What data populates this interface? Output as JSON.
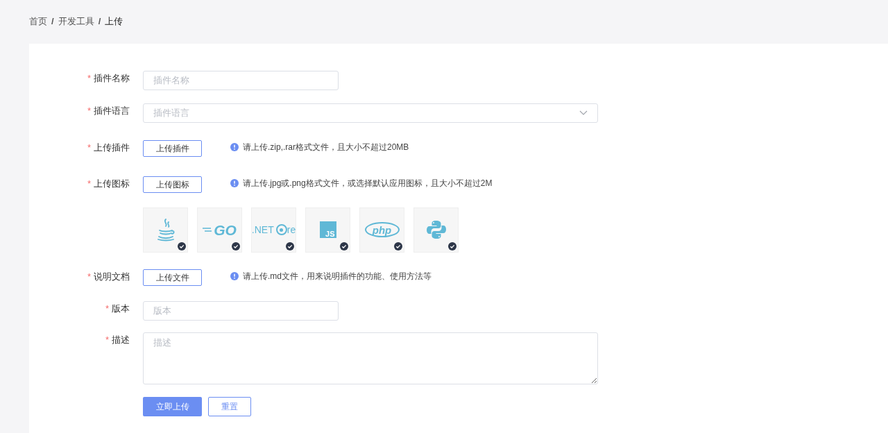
{
  "breadcrumb": [
    {
      "label": "首页",
      "current": false
    },
    {
      "label": "开发工具",
      "current": false
    },
    {
      "label": "上传",
      "current": true
    }
  ],
  "separator": "/",
  "form": {
    "fields": [
      {
        "kind": "input",
        "label": "插件名称",
        "required_mark": "*",
        "placeholder": "插件名称"
      },
      {
        "kind": "select",
        "label": "插件语言",
        "required_mark": "*",
        "placeholder": "插件语言"
      },
      {
        "kind": "upload",
        "label": "上传插件",
        "required_mark": "*",
        "button": "上传插件",
        "hint": "请上传.zip,.rar格式文件，且大小不超过20MB"
      },
      {
        "kind": "upload",
        "label": "上传图标",
        "required_mark": "*",
        "button": "上传图标",
        "hint": "请上传.jpg或.png格式文件，或选择默认应用图标，且大小不超过2M"
      },
      {
        "kind": "icons",
        "icons": [
          {
            "kind": "cup",
            "checked": true
          },
          {
            "kind": "go",
            "text": "GO",
            "checked": true
          },
          {
            "kind": "net",
            "text": ".NET",
            "suffix": "re",
            "checked": true
          },
          {
            "kind": "js",
            "text": "JS",
            "checked": true
          },
          {
            "kind": "php",
            "text": "php",
            "checked": true
          },
          {
            "kind": "snake",
            "checked": true
          }
        ]
      },
      {
        "kind": "upload",
        "label": "说明文档",
        "required_mark": "*",
        "button": "上传文件",
        "hint": "请上传.md文件，用来说明插件的功能、使用方法等"
      },
      {
        "kind": "input",
        "label": "版本",
        "required_mark": "*",
        "placeholder": "版本"
      },
      {
        "kind": "textarea",
        "label": "描述",
        "required_mark": "*",
        "placeholder": "描述"
      }
    ],
    "actions": [
      {
        "label": "立即上传",
        "primary": true
      },
      {
        "label": "重置",
        "primary": false
      }
    ]
  }
}
